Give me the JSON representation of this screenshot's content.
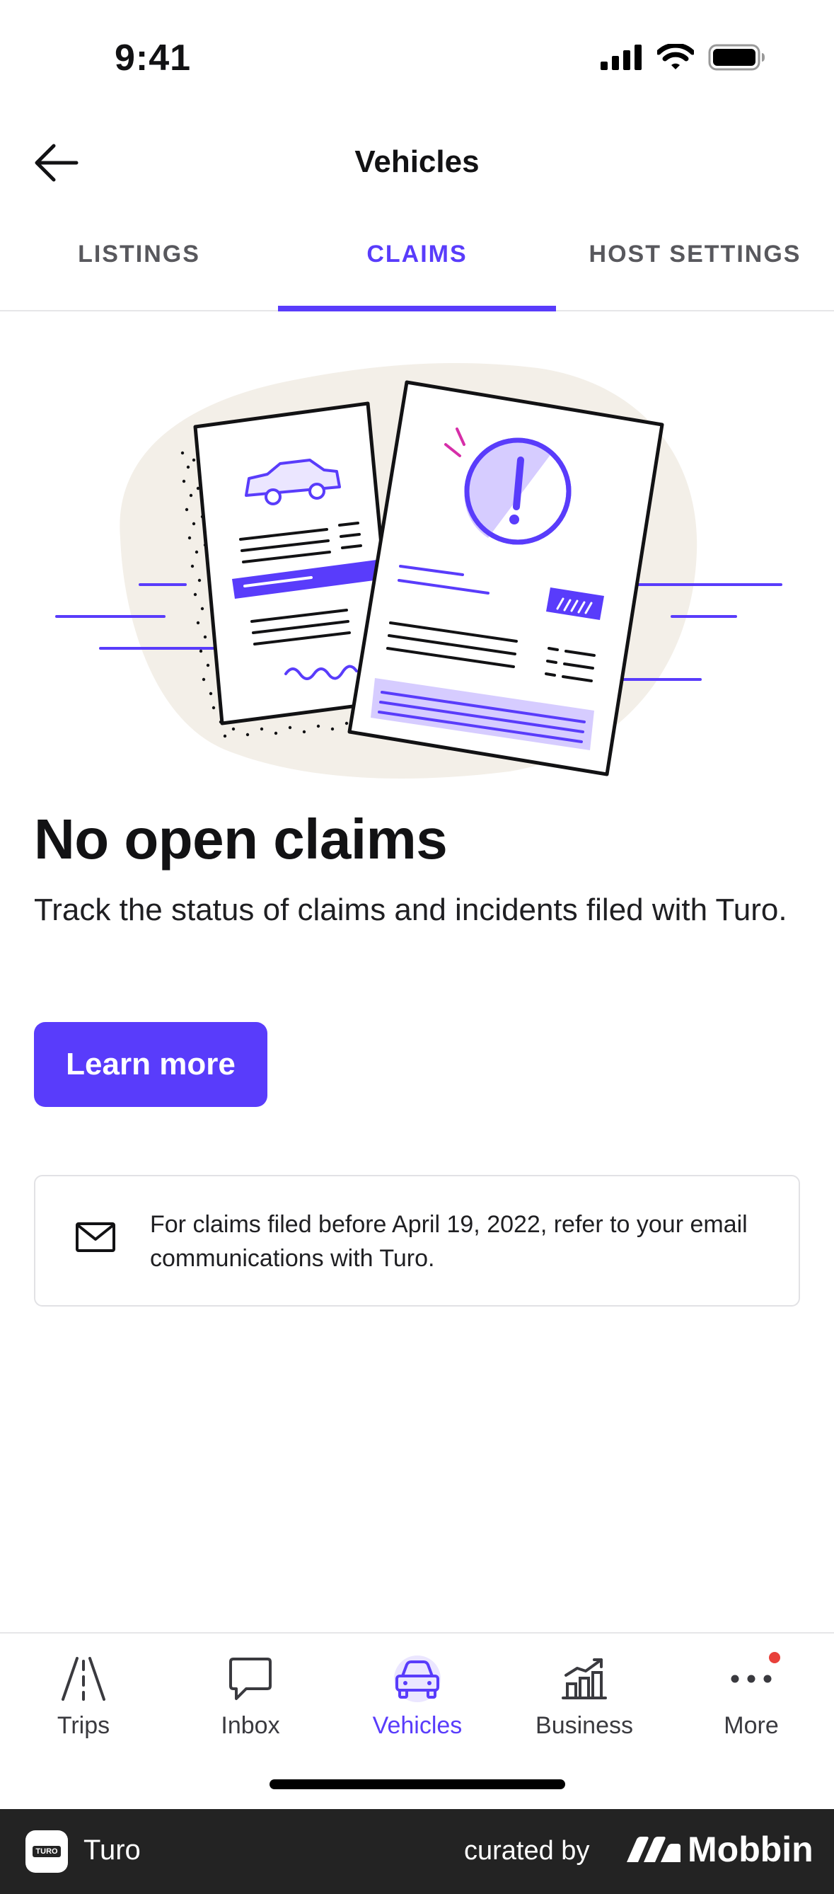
{
  "status_bar": {
    "time": "9:41"
  },
  "header": {
    "title": "Vehicles"
  },
  "tabs": [
    {
      "label": "LISTINGS",
      "active": false
    },
    {
      "label": "CLAIMS",
      "active": true
    },
    {
      "label": "HOST SETTINGS",
      "active": false
    }
  ],
  "empty_state": {
    "title": "No open claims",
    "description": "Track the status of claims and incidents filed with Turo.",
    "button_label": "Learn more"
  },
  "info_card": {
    "icon": "mail-icon",
    "text": "For claims filed before April 19, 2022, refer to your email communications with Turo."
  },
  "tab_bar": {
    "items": [
      {
        "label": "Trips",
        "icon": "road-icon",
        "active": false
      },
      {
        "label": "Inbox",
        "icon": "chat-icon",
        "active": false
      },
      {
        "label": "Vehicles",
        "icon": "car-icon",
        "active": true
      },
      {
        "label": "Business",
        "icon": "chart-icon",
        "active": false
      },
      {
        "label": "More",
        "icon": "more-icon",
        "active": false,
        "notification": true
      }
    ]
  },
  "footer": {
    "app_name": "Turo",
    "curated_by": "curated by",
    "brand": "Mobbin"
  },
  "colors": {
    "accent": "#593cfb",
    "accent_light": "#ebe6ff",
    "blob": "#f3efe8",
    "notification": "#e8403a"
  }
}
